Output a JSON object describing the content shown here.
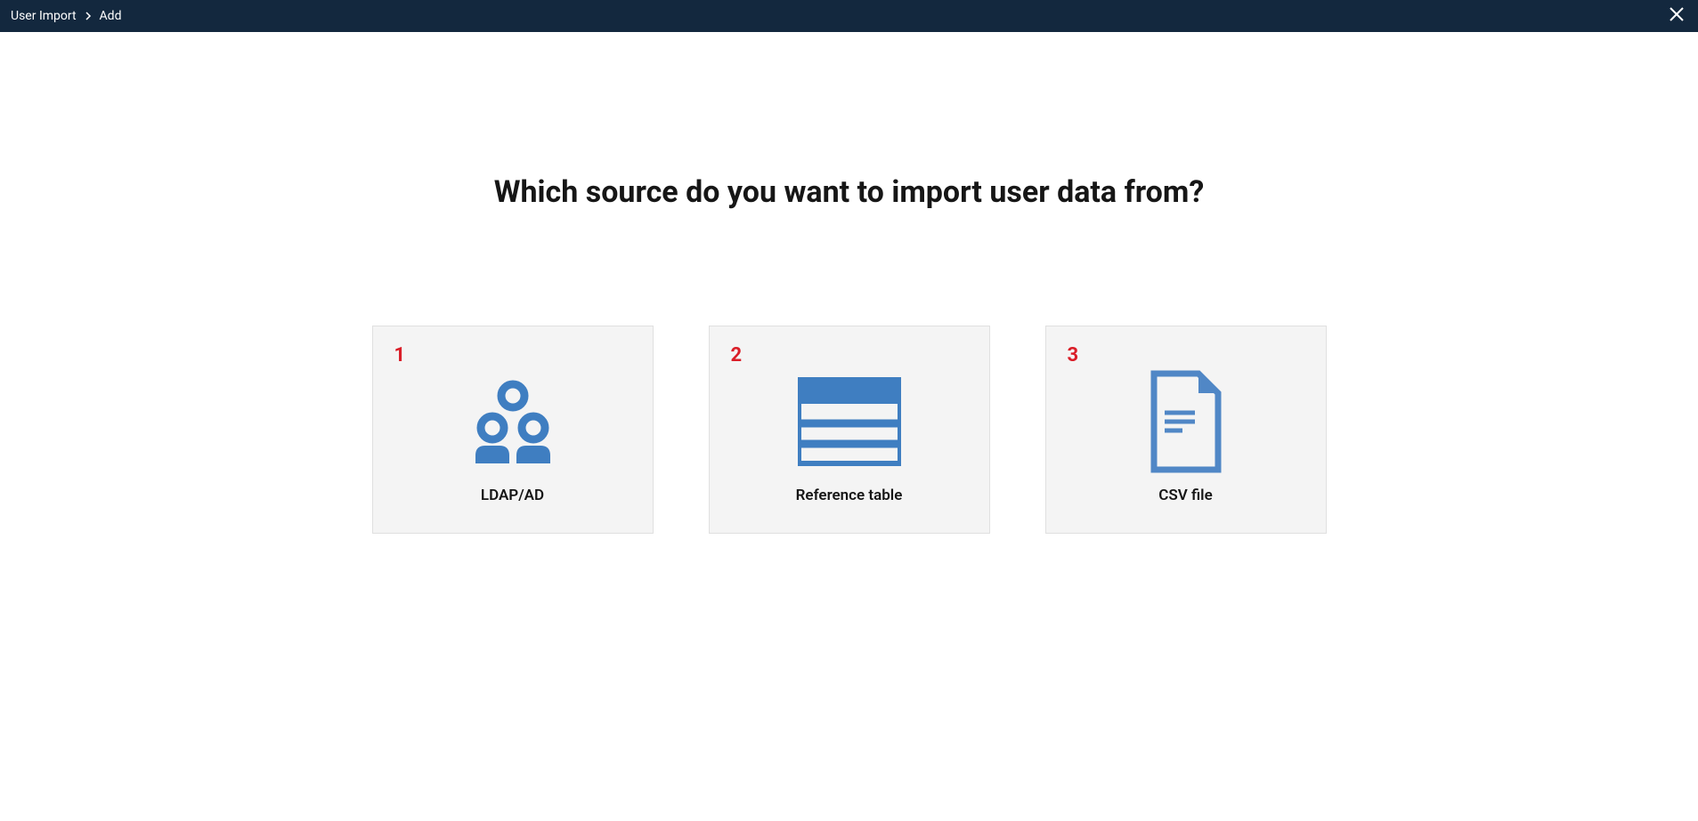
{
  "header": {
    "breadcrumb": {
      "parent": "User Import",
      "current": "Add"
    }
  },
  "main": {
    "title": "Which source do you want to import user data from?",
    "cards": [
      {
        "number": "1",
        "label": "LDAP/AD",
        "icon": "ldap-ad"
      },
      {
        "number": "2",
        "label": "Reference table",
        "icon": "reference-table"
      },
      {
        "number": "3",
        "label": "CSV file",
        "icon": "csv-file"
      }
    ]
  },
  "colors": {
    "headerBg": "#13283e",
    "iconBlue": "#4a80c0",
    "numberRed": "#da1e28",
    "cardBg": "#f4f4f4"
  }
}
